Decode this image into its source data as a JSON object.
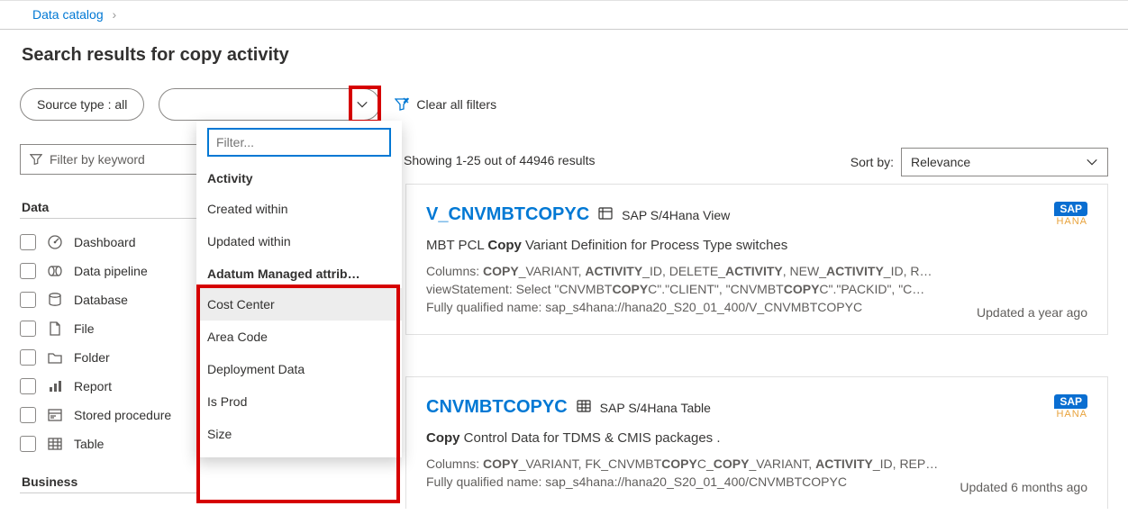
{
  "breadcrumb": {
    "root": "Data catalog"
  },
  "title": "Search results for copy activity",
  "filters": {
    "source_type_label": "Source type : all",
    "clear_label": "Clear all filters"
  },
  "dropdown": {
    "filter_placeholder": "Filter...",
    "section_activity": "Activity",
    "created_within": "Created within",
    "updated_within": "Updated within",
    "section_adatum": "Adatum Managed attrib…",
    "cost_center": "Cost Center",
    "area_code": "Area Code",
    "deployment_data": "Deployment Data",
    "is_prod": "Is Prod",
    "size": "Size"
  },
  "sidebar": {
    "filter_keyword": "Filter by keyword",
    "section_data": "Data",
    "section_business": "Business",
    "facets": [
      {
        "label": "Dashboard",
        "icon": "gauge"
      },
      {
        "label": "Data pipeline",
        "icon": "pipeline"
      },
      {
        "label": "Database",
        "icon": "database"
      },
      {
        "label": "File",
        "icon": "file"
      },
      {
        "label": "Folder",
        "icon": "folder"
      },
      {
        "label": "Report",
        "icon": "report"
      },
      {
        "label": "Stored procedure",
        "icon": "procedure"
      },
      {
        "label": "Table",
        "icon": "table"
      }
    ]
  },
  "results": {
    "showing": "Showing 1-25 out of 44946 results",
    "sort_by_label": "Sort by:",
    "sort_value": "Relevance",
    "items": [
      {
        "title": "V_CNVMBTCOPYC",
        "asset_type": "SAP S/4Hana View",
        "subtitle_pre": "MBT PCL ",
        "subtitle_bold": "Copy",
        "subtitle_post": " Variant Definition for Process Type switches",
        "columns_html": "Columns: <b>COPY</b>_VARIANT, <b>ACTIVITY</b>_ID, DELETE_<b>ACTIVITY</b>, NEW_<b>ACTIVITY</b>_ID, R…",
        "view_html": "viewStatement: Select \"CNVMBT<b>COPY</b>C\".\"CLIENT\", \"CNVMBT<b>COPY</b>C\".\"PACKID\", \"C…",
        "fqn": "Fully qualified name: sap_s4hana://hana20_S20_01_400/V_CNVMBTCOPYC",
        "updated": "Updated a year ago"
      },
      {
        "title": "CNVMBTCOPYC",
        "asset_type": "SAP S/4Hana Table",
        "subtitle_bold": "Copy",
        "subtitle_post": " Control Data for TDMS & CMIS packages .",
        "columns_html": "Columns: <b>COPY</b>_VARIANT, FK_CNVMBT<b>COPY</b>C_<b>COPY</b>_VARIANT, <b>ACTIVITY</b>_ID, REP…",
        "fqn": "Fully qualified name: sap_s4hana://hana20_S20_01_400/CNVMBTCOPYC",
        "updated": "Updated 6 months ago"
      }
    ]
  }
}
